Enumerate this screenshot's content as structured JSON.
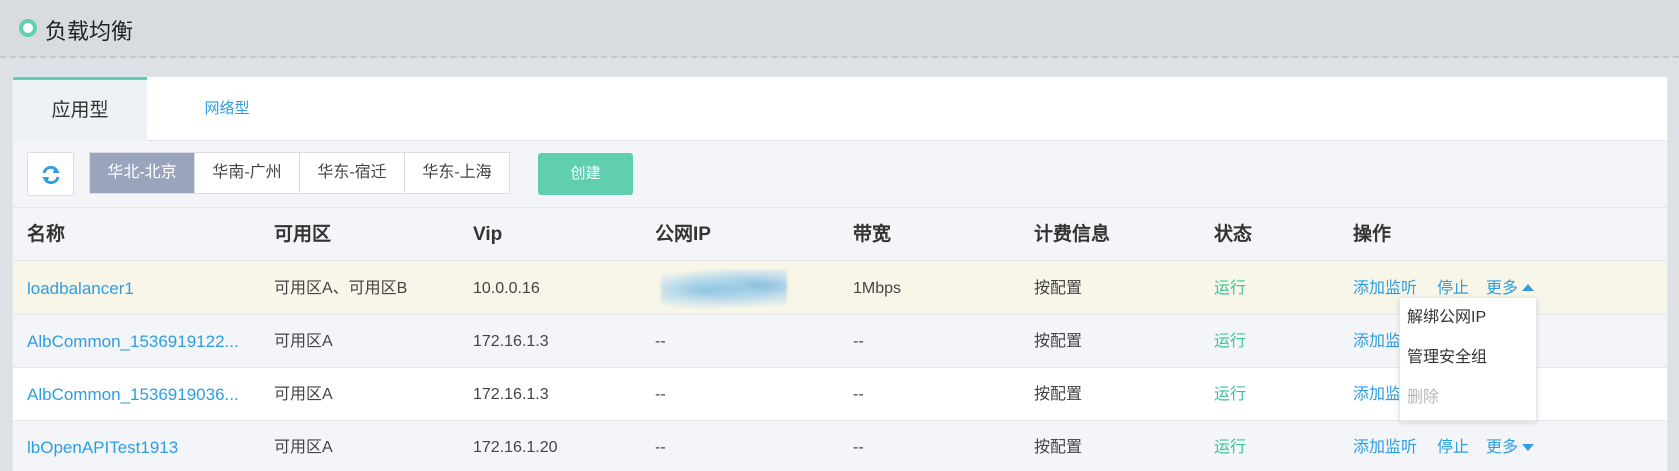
{
  "page_title": "负载均衡",
  "tabs": [
    {
      "label": "应用型",
      "active": true
    },
    {
      "label": "网络型",
      "active": false
    }
  ],
  "regions": [
    {
      "label": "华北-北京",
      "selected": true
    },
    {
      "label": "华南-广州",
      "selected": false
    },
    {
      "label": "华东-宿迁",
      "selected": false
    },
    {
      "label": "华东-上海",
      "selected": false
    }
  ],
  "toolbar": {
    "create_label": "创建",
    "refresh_icon": "refresh-icon"
  },
  "table": {
    "headers": [
      "名称",
      "可用区",
      "Vip",
      "公网IP",
      "带宽",
      "计费信息",
      "状态",
      "操作"
    ],
    "rows": [
      {
        "name": "loadbalancer1",
        "zone": "可用区A、可用区B",
        "vip": "10.0.0.16",
        "public_ip": "",
        "bandwidth": "1Mbps",
        "billing": "按配置",
        "status": "运行",
        "op_add": "添加监听",
        "op_stop": "停止",
        "op_more": "更多"
      },
      {
        "name": "AlbCommon_1536919122...",
        "zone": "可用区A",
        "vip": "172.16.1.3",
        "public_ip": "--",
        "bandwidth": "--",
        "billing": "按配置",
        "status": "运行",
        "op_add": "添加监",
        "op_stop": "",
        "op_more": ""
      },
      {
        "name": "AlbCommon_1536919036...",
        "zone": "可用区A",
        "vip": "172.16.1.3",
        "public_ip": "--",
        "bandwidth": "--",
        "billing": "按配置",
        "status": "运行",
        "op_add": "添加监",
        "op_stop": "",
        "op_more": ""
      },
      {
        "name": "lbOpenAPITest1913",
        "zone": "可用区A",
        "vip": "172.16.1.20",
        "public_ip": "--",
        "bandwidth": "--",
        "billing": "按配置",
        "status": "运行",
        "op_add": "添加监听",
        "op_stop": "停止",
        "op_more": "更多"
      }
    ]
  },
  "dropdown": {
    "items": [
      {
        "label": "解绑公网IP",
        "disabled": false
      },
      {
        "label": "管理安全组",
        "disabled": false
      },
      {
        "label": "删除",
        "disabled": true
      }
    ]
  },
  "colors": {
    "accent": "#5fd0b2",
    "link": "#2e9ee0",
    "status_running": "#3dc39b",
    "region_selected": "#9aa4bc"
  }
}
